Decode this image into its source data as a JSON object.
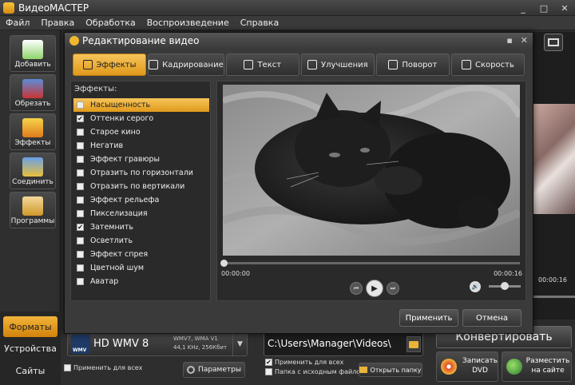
{
  "window": {
    "title": "ВидеоМАСТЕР",
    "controls": {
      "minimize": "_",
      "maximize": "□",
      "close": "✕"
    }
  },
  "menu": [
    "Файл",
    "Правка",
    "Обработка",
    "Воспроизведение",
    "Справка"
  ],
  "sidebar": {
    "tools": [
      {
        "label": "Добавить",
        "icon": "add-file-icon"
      },
      {
        "label": "Обрезать",
        "icon": "scissors-icon"
      },
      {
        "label": "Эффекты",
        "icon": "magic-wand-icon"
      },
      {
        "label": "Соединить",
        "icon": "join-icon"
      },
      {
        "label": "Программы",
        "icon": "programs-icon"
      }
    ],
    "bottom_tabs": [
      {
        "label": "Форматы",
        "active": true
      },
      {
        "label": "Устройства",
        "active": false
      },
      {
        "label": "Сайты",
        "active": false
      }
    ]
  },
  "dialog": {
    "title": "Редактирование видео",
    "controls": {
      "minimize": "▪",
      "close": "✕"
    },
    "tabs": [
      {
        "label": "Эффекты",
        "icon": "effects-icon",
        "active": true
      },
      {
        "label": "Кадрирование",
        "icon": "crop-icon",
        "active": false
      },
      {
        "label": "Текст",
        "icon": "text-icon",
        "active": false
      },
      {
        "label": "Улучшения",
        "icon": "enhance-icon",
        "active": false
      },
      {
        "label": "Поворот",
        "icon": "rotate-icon",
        "active": false
      },
      {
        "label": "Скорость",
        "icon": "speed-icon",
        "active": false
      }
    ],
    "effects_header": "Эффекты:",
    "effects": [
      {
        "label": "Насыщенность",
        "checked": false,
        "selected": true
      },
      {
        "label": "Оттенки серого",
        "checked": true,
        "selected": false
      },
      {
        "label": "Старое кино",
        "checked": false,
        "selected": false
      },
      {
        "label": "Негатив",
        "checked": false,
        "selected": false
      },
      {
        "label": "Эффект гравюры",
        "checked": false,
        "selected": false
      },
      {
        "label": "Отразить по горизонтали",
        "checked": false,
        "selected": false
      },
      {
        "label": "Отразить по вертикали",
        "checked": false,
        "selected": false
      },
      {
        "label": "Эффект рельефа",
        "checked": false,
        "selected": false
      },
      {
        "label": "Пикселизация",
        "checked": false,
        "selected": false
      },
      {
        "label": "Затемнить",
        "checked": true,
        "selected": false
      },
      {
        "label": "Осветлить",
        "checked": false,
        "selected": false
      },
      {
        "label": "Эффект спрея",
        "checked": false,
        "selected": false
      },
      {
        "label": "Цветной шум",
        "checked": false,
        "selected": false
      },
      {
        "label": "Аватар",
        "checked": false,
        "selected": false
      }
    ],
    "player": {
      "time_current": "00:00:00",
      "time_total": "00:00:16",
      "position_fraction": 0,
      "volume_fraction": 0.5,
      "prev_symbol": "⏮",
      "play_symbol": "▶",
      "next_symbol": "⏭",
      "volume_symbol": "🔊"
    },
    "apply_label": "Применить",
    "cancel_label": "Отмена"
  },
  "right_panel": {
    "time": "00:00:16"
  },
  "bottom": {
    "format_name": "HD WMV 8",
    "format_codec_line1": "WMV7, WMA V1",
    "format_codec_line2": "44,1 KHz, 256Кбит",
    "format_badge": "WMV",
    "format_arrow": "▼",
    "apply_all_label": "Применить для всех",
    "params_label": "Параметры",
    "output_path": "C:\\Users\\Manager\\Videos\\",
    "apply_all_output_label": "Применить для всех",
    "apply_all_output_checked": true,
    "source_folder_label": "Папка с исходным файлом",
    "open_folder_label": "Открыть папку",
    "convert_label": "Конвертировать",
    "burn_dvd_label": "Записать DVD",
    "publish_label": "Разместить на сайте"
  },
  "colors": {
    "accent": "#e09a1c",
    "accent_light": "#f6c45a",
    "background": "#2b2b2b",
    "panel": "#3a3a3a"
  }
}
